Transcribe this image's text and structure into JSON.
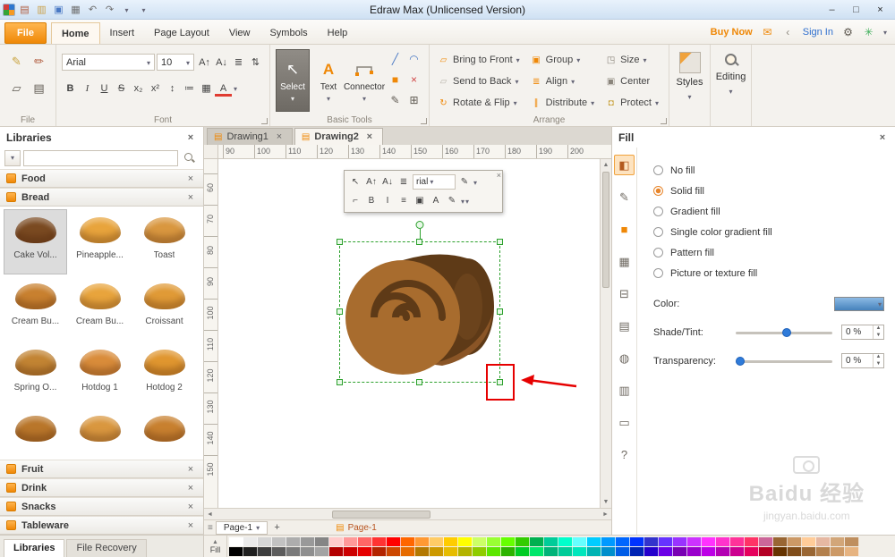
{
  "colors": {
    "accent_orange": "#ef8807",
    "selection_green": "#2ca02c",
    "highlight_red": "#e60000",
    "swatch_blue": "#4f94d6",
    "roll_dark_brown": "#5e3a17",
    "roll_light_brown": "#a86c2e"
  },
  "titlebar": {
    "title": "Edraw Max (Unlicensed Version)",
    "qat_icons": [
      {
        "name": "new-drawing-icon",
        "glyph": "▤",
        "color": "#b05a3c"
      },
      {
        "name": "open-file-icon",
        "glyph": "▥",
        "color": "#caa14a"
      },
      {
        "name": "save-icon",
        "glyph": "▣",
        "color": "#4a79c4"
      },
      {
        "name": "print-icon",
        "glyph": "▦",
        "color": "#6f6f6f"
      },
      {
        "name": "undo-icon",
        "glyph": "↶",
        "color": "#6f6f6f"
      },
      {
        "name": "redo-icon",
        "glyph": "↷",
        "color": "#6f6f6f"
      }
    ],
    "window_controls": [
      {
        "name": "minimize-button",
        "glyph": "–"
      },
      {
        "name": "maximize-button",
        "glyph": "□"
      },
      {
        "name": "close-button",
        "glyph": "×"
      }
    ]
  },
  "menubar": {
    "tabs": [
      {
        "name": "menu-tab-file",
        "label": "File",
        "cls": "file"
      },
      {
        "name": "menu-tab-home",
        "label": "Home",
        "active": true
      },
      {
        "name": "menu-tab-insert",
        "label": "Insert"
      },
      {
        "name": "menu-tab-page-layout",
        "label": "Page Layout"
      },
      {
        "name": "menu-tab-view",
        "label": "View"
      },
      {
        "name": "menu-tab-symbols",
        "label": "Symbols"
      },
      {
        "name": "menu-tab-help",
        "label": "Help"
      }
    ],
    "buy_now": "Buy Now",
    "sign_in": "Sign In",
    "icons_left": [
      {
        "name": "mail-icon",
        "glyph": "✉",
        "color": "#ef8807"
      },
      {
        "name": "share-icon",
        "glyph": "‹",
        "color": "#8f8a80"
      }
    ],
    "icons_right": [
      {
        "name": "settings-gear-icon",
        "glyph": "⚙",
        "color": "#5f5a52"
      },
      {
        "name": "apps-icon",
        "glyph": "✳",
        "color": "#3fae5a"
      }
    ]
  },
  "ribbon": {
    "font_name": "Arial",
    "font_size": "10",
    "file_icons": [
      {
        "name": "format-painter-icon",
        "glyph": "✎",
        "color": "#c9a13a"
      },
      {
        "name": "brush-icon",
        "glyph": "✏",
        "color": "#b05a3c"
      },
      {
        "name": "copy-icon",
        "glyph": "▱",
        "color": "#5f5a52"
      },
      {
        "name": "paste-icon",
        "glyph": "▤",
        "color": "#5f5a52"
      }
    ],
    "font_row1_icons": [
      {
        "name": "increase-font-size-icon",
        "glyph": "A↑"
      },
      {
        "name": "decrease-font-size-icon",
        "glyph": "A↓"
      },
      {
        "name": "text-align-icon",
        "glyph": "≣"
      },
      {
        "name": "char-spacing-icon",
        "glyph": "⇅"
      }
    ],
    "font_row2_icons": [
      {
        "name": "bold-button",
        "glyph": "B",
        "cls": "b"
      },
      {
        "name": "italic-button",
        "glyph": "I",
        "cls": "i"
      },
      {
        "name": "underline-button",
        "glyph": "U",
        "cls": "u"
      },
      {
        "name": "strikethrough-button",
        "glyph": "S",
        "cls": "s"
      },
      {
        "name": "subscript-button",
        "glyph": "x₂"
      },
      {
        "name": "superscript-button",
        "glyph": "x²"
      },
      {
        "name": "line-spacing-button",
        "glyph": "↕"
      },
      {
        "name": "bullets-button",
        "glyph": "≔"
      },
      {
        "name": "table-button",
        "glyph": "▦"
      },
      {
        "name": "font-color-button",
        "glyph": "A",
        "cls": "fc"
      }
    ],
    "basic_tools": {
      "select": "Select",
      "text": "Text",
      "connector": "Connector",
      "select_icon": "↖",
      "text_icon": "A"
    },
    "small_tools": [
      {
        "name": "line-tool-icon",
        "glyph": "╱",
        "color": "#4a79c4"
      },
      {
        "name": "curve-tool-icon",
        "glyph": "◠",
        "color": "#4a79c4"
      },
      {
        "name": "rectangle-tool-icon",
        "glyph": "■",
        "color": "#ef8807"
      },
      {
        "name": "erase-tool-icon",
        "glyph": "×",
        "color": "#d04545"
      },
      {
        "name": "pen-tool-icon",
        "glyph": "✎",
        "color": "#5f5a52"
      },
      {
        "name": "crop-tool-icon",
        "glyph": "⊞",
        "color": "#5f5a52"
      }
    ],
    "arrange_col1": [
      {
        "name": "bring-to-front-button",
        "icon": "▱",
        "color": "#ef8807",
        "label": "Bring to Front"
      },
      {
        "name": "send-to-back-button",
        "icon": "▱",
        "color": "#b9b4aa",
        "label": "Send to Back"
      },
      {
        "name": "rotate-flip-button",
        "icon": "↻",
        "color": "#ef8807",
        "label": "Rotate & Flip"
      }
    ],
    "arrange_col2": [
      {
        "name": "group-button",
        "icon": "▣",
        "color": "#ef8807",
        "label": "Group"
      },
      {
        "name": "align-button",
        "icon": "≣",
        "color": "#ef8807",
        "label": "Align"
      },
      {
        "name": "distribute-button",
        "icon": "∥",
        "color": "#ef8807",
        "label": "Distribute"
      }
    ],
    "arrange_col3": [
      {
        "name": "size-button",
        "icon": "◳",
        "color": "#8a857b",
        "label": "Size"
      },
      {
        "name": "center-button",
        "icon": "▣",
        "color": "#8a857b",
        "label": "Center",
        "cls": "nocaret"
      },
      {
        "name": "protect-button",
        "icon": "◘",
        "color": "#c9a13a",
        "label": "Protect"
      }
    ],
    "groups": {
      "file": "File",
      "font": "Font",
      "basic": "Basic Tools",
      "arrange": "Arrange"
    },
    "styles_label": "Styles",
    "editing_label": "Editing"
  },
  "libraries": {
    "title": "Libraries",
    "categories_top": [
      {
        "name": "category-food",
        "label": "Food"
      },
      {
        "name": "category-bread",
        "label": "Bread"
      }
    ],
    "bread_items": [
      {
        "label": "Cake Vol...",
        "color": "#7a4a21",
        "selected": true
      },
      {
        "label": "Pineapple...",
        "color": "#e8a43c"
      },
      {
        "label": "Toast",
        "color": "#d9973f"
      },
      {
        "label": "Cream Bu...",
        "color": "#c8802f"
      },
      {
        "label": "Cream Bu...",
        "color": "#e8a43c"
      },
      {
        "label": "Croissant",
        "color": "#e09a36"
      },
      {
        "label": "Spring O...",
        "color": "#c28433"
      },
      {
        "label": "Hotdog 1",
        "color": "#d98c3a"
      },
      {
        "label": "Hotdog 2",
        "color": "#e0962f"
      },
      {
        "label": "",
        "color": "#b9762a"
      },
      {
        "label": "",
        "color": "#d9973f"
      },
      {
        "label": "",
        "color": "#c8802f"
      }
    ],
    "categories_bottom": [
      {
        "name": "category-fruit",
        "label": "Fruit"
      },
      {
        "name": "category-drink",
        "label": "Drink"
      },
      {
        "name": "category-snacks",
        "label": "Snacks"
      },
      {
        "name": "category-tableware",
        "label": "Tableware"
      }
    ]
  },
  "canvas": {
    "tabs": [
      {
        "name": "doc-tab-drawing1",
        "label": "Drawing1"
      },
      {
        "name": "doc-tab-drawing2",
        "label": "Drawing2",
        "active": true
      }
    ],
    "hruler": [
      "90",
      "100",
      "110",
      "120",
      "130",
      "140",
      "150",
      "160",
      "170",
      "180",
      "190",
      "200"
    ],
    "vruler": [
      "60",
      "70",
      "80",
      "90",
      "100",
      "110",
      "120",
      "130",
      "140",
      "150"
    ],
    "mini_toolbar": {
      "font_value": "rial",
      "row1_icons": [
        {
          "name": "select-tool-icon",
          "glyph": "↖"
        },
        {
          "name": "grow-font-icon",
          "glyph": "A↑"
        },
        {
          "name": "shrink-font-icon",
          "glyph": "A↓"
        },
        {
          "name": "align-icon",
          "glyph": "≣"
        }
      ],
      "row1_after": [
        {
          "name": "format-painter-icon",
          "glyph": "✎"
        }
      ],
      "row2_icons": [
        {
          "name": "connector-icon",
          "glyph": "⌐"
        },
        {
          "name": "bold-icon",
          "glyph": "B",
          "cls": "b"
        },
        {
          "name": "italic-icon",
          "glyph": "I",
          "cls": "i"
        },
        {
          "name": "spacing-icon",
          "glyph": "≡"
        },
        {
          "name": "fill-color-icon",
          "glyph": "▣"
        },
        {
          "name": "text-color-icon",
          "glyph": "A",
          "cls": "fc"
        },
        {
          "name": "line-color-icon",
          "glyph": "✎"
        }
      ]
    },
    "pagebar": {
      "tab": "Page-1",
      "label": "Page-1"
    }
  },
  "fill": {
    "title": "Fill",
    "side_icons": [
      {
        "name": "fill-pane-icon",
        "glyph": "◧",
        "color": "#b35a1f",
        "active": true
      },
      {
        "name": "line-pane-icon",
        "glyph": "✎",
        "color": "#6f6a62"
      },
      {
        "name": "shape-pane-icon",
        "glyph": "■",
        "color": "#ef8807"
      },
      {
        "name": "picture-pane-icon",
        "glyph": "▦",
        "color": "#6f6a62"
      },
      {
        "name": "layers-pane-icon",
        "glyph": "⊟",
        "color": "#6f6a62"
      },
      {
        "name": "page-pane-icon",
        "glyph": "▤",
        "color": "#6f6a62"
      },
      {
        "name": "theme-pane-icon",
        "glyph": "◍",
        "color": "#6f6a62"
      },
      {
        "name": "document-pane-icon",
        "glyph": "▥",
        "color": "#6f6a62"
      },
      {
        "name": "comment-pane-icon",
        "glyph": "▭",
        "color": "#6f6a62"
      },
      {
        "name": "help-pane-icon",
        "glyph": "?",
        "color": "#6f6a62"
      }
    ],
    "options": [
      {
        "name": "option-no-fill",
        "label": "No fill"
      },
      {
        "name": "option-solid-fill",
        "label": "Solid fill",
        "selected": true
      },
      {
        "name": "option-gradient-fill",
        "label": "Gradient fill"
      },
      {
        "name": "option-single-color-gradient-fill",
        "label": "Single color gradient fill"
      },
      {
        "name": "option-pattern-fill",
        "label": "Pattern fill"
      },
      {
        "name": "option-picture-texture-fill",
        "label": "Picture or texture fill"
      }
    ],
    "color_label": "Color:",
    "swatch_color": "#4f94d6",
    "shade_label": "Shade/Tint:",
    "shade_value": "0 %",
    "transparency_label": "Transparency:",
    "transparency_value": "0 %"
  },
  "statusbar": {
    "lib_tabs": [
      {
        "name": "panel-tab-libraries",
        "label": "Libraries",
        "active": true
      },
      {
        "name": "panel-tab-file-recovery",
        "label": "File Recovery"
      }
    ],
    "fill_pane_label": "Fill",
    "palette_row1": [
      "#ffffff",
      "#ebebeb",
      "#d6d6d6",
      "#c2c2c2",
      "#adadad",
      "#999999",
      "#858585",
      "#ffcccc",
      "#ff9999",
      "#ff6666",
      "#ff3333",
      "#ff0000",
      "#ff6600",
      "#ff9933",
      "#ffcc66",
      "#ffcc00",
      "#ffff00",
      "#ccff66",
      "#99ff33",
      "#66ff00",
      "#33cc00",
      "#00b050",
      "#00cc99",
      "#00ffcc",
      "#66ffff",
      "#00ccff",
      "#0099ff",
      "#0066ff",
      "#0033ff",
      "#3333cc",
      "#6633ff",
      "#9933ff",
      "#cc33ff",
      "#ff33ff",
      "#ff33cc",
      "#ff3399",
      "#ff3366",
      "#cc6699",
      "#996633",
      "#cc9966",
      "#ffcc99",
      "#e6b8a2",
      "#d2a679",
      "#bf8f5f"
    ],
    "palette_row2": [
      "#000000",
      "#1f1f1f",
      "#3d3d3d",
      "#5c5c5c",
      "#7a7a7a",
      "#8f8f8f",
      "#a3a3a3",
      "#b30000",
      "#cc0000",
      "#e60000",
      "#b32400",
      "#cc4700",
      "#e66b00",
      "#b37800",
      "#cc9900",
      "#e6bc00",
      "#b3b300",
      "#8fcc00",
      "#5ce600",
      "#2db300",
      "#00cc24",
      "#00e66b",
      "#00b378",
      "#00cc99",
      "#00e6bc",
      "#00b3b3",
      "#008fcc",
      "#005ce6",
      "#0024b3",
      "#2400cc",
      "#6b00e6",
      "#7800b3",
      "#9900cc",
      "#bc00e6",
      "#b300b3",
      "#cc008f",
      "#e6005c",
      "#b30024",
      "#663300",
      "#804d1a",
      "#996633",
      "#b3804d",
      "#cc9966",
      "#e6b380"
    ]
  },
  "watermark": {
    "brand": "Baidu",
    "cn": "经验",
    "url": "jingyan.baidu.com"
  }
}
